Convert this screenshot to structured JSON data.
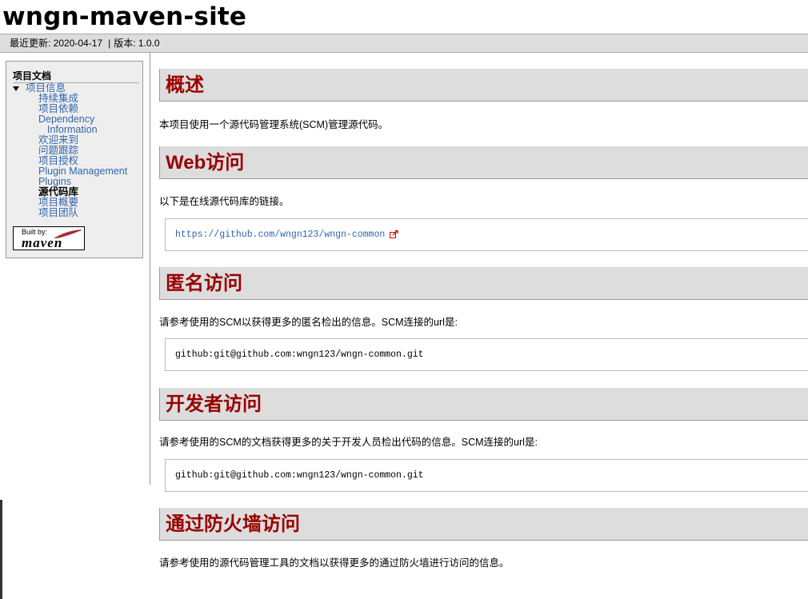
{
  "site": {
    "title": "wngn-maven-site"
  },
  "breadcrumbs": {
    "last_published": "最近更新: 2020-04-17",
    "separator": "|",
    "version": "版本: 1.0.0"
  },
  "sidebar": {
    "heading": "项目文档",
    "parent_item": "项目信息",
    "items": [
      {
        "label": "持续集成",
        "current": false
      },
      {
        "label": "项目依赖",
        "current": false
      },
      {
        "label": "Dependency",
        "label_cont": "Information",
        "current": false
      },
      {
        "label": "欢迎来到",
        "current": false
      },
      {
        "label": "问题跟踪",
        "current": false
      },
      {
        "label": "项目授权",
        "current": false
      },
      {
        "label": "Plugin Management",
        "current": false
      },
      {
        "label": "Plugins",
        "current": false
      },
      {
        "label": "源代码库",
        "current": true
      },
      {
        "label": "项目概要",
        "current": false
      },
      {
        "label": "项目团队",
        "current": false
      }
    ],
    "powered_by": {
      "built_by": "Built by:",
      "logo_text": "maven"
    }
  },
  "main": {
    "sections": [
      {
        "title": "概述",
        "text": "本项目使用一个源代码管理系统(SCM)管理源代码。"
      },
      {
        "title": "Web访问",
        "text": "以下是在线源代码库的链接。",
        "source": "https://github.com/wngn123/wngn-common"
      },
      {
        "title": "匿名访问",
        "text": "请参考使用的SCM以获得更多的匿名检出的信息。SCM连接的url是:",
        "source": "github:git@github.com:wngn123/wngn-common.git"
      },
      {
        "title": "开发者访问",
        "text": "请参考使用的SCM的文档获得更多的关于开发人员检出代码的信息。SCM连接的url是:",
        "source": "github:git@github.com:wngn123/wngn-common.git"
      },
      {
        "title": "通过防火墙访问",
        "text": "请参考使用的源代码管理工具的文档以获得更多的通过防火墙进行访问的信息。"
      }
    ]
  },
  "colors": {
    "section_title": "#990000",
    "link": "#3366aa",
    "section_bg": "#dddddd"
  },
  "icons": {
    "external_link": "external-link-icon",
    "expanded": "triangle-down-icon",
    "logo_feather": "maven-feather-icon"
  }
}
